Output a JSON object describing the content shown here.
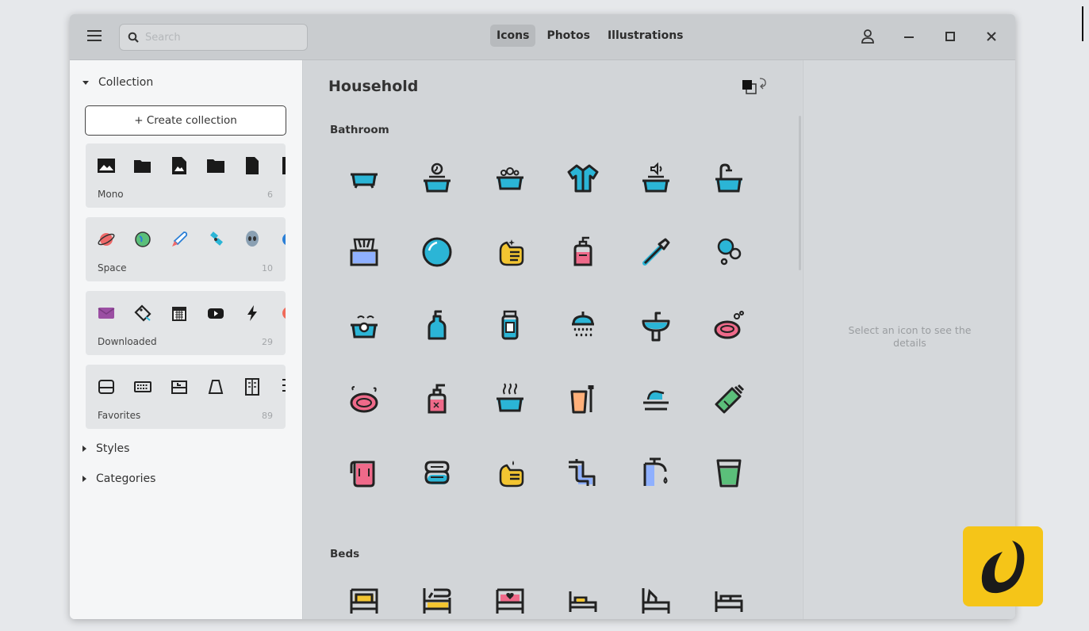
{
  "search": {
    "placeholder": "Search"
  },
  "tabs": [
    {
      "label": "Icons",
      "active": true
    },
    {
      "label": "Photos",
      "active": false
    },
    {
      "label": "Illustrations",
      "active": false
    }
  ],
  "sidebar": {
    "collection_header": "Collection",
    "create_collection": "+ Create collection",
    "collections": [
      {
        "name": "Mono",
        "count": "6"
      },
      {
        "name": "Space",
        "count": "10"
      },
      {
        "name": "Downloaded",
        "count": "29"
      },
      {
        "name": "Favorites",
        "count": "89"
      }
    ],
    "styles_header": "Styles",
    "categories_header": "Categories"
  },
  "main": {
    "title": "Household",
    "sections": [
      {
        "label": "Bathroom"
      },
      {
        "label": "Beds"
      }
    ]
  },
  "details": {
    "empty_text": "Select an icon to see the details"
  },
  "colors": {
    "accent_cyan": "#2bb5d6",
    "accent_pink": "#ef6a8a",
    "accent_yellow": "#f3c531",
    "brand_yellow": "#f5c518"
  }
}
